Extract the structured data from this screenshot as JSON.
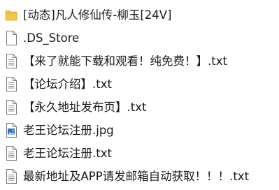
{
  "files": [
    {
      "name": "[动态]凡人修仙传-柳玉[24V]",
      "icon": "folder-icon"
    },
    {
      "name": ".DS_Store",
      "icon": "blank-file-icon"
    },
    {
      "name": "【来了就能下载和观看！纯免费！】.txt",
      "icon": "text-file-icon"
    },
    {
      "name": "【论坛介绍】.txt",
      "icon": "text-file-icon"
    },
    {
      "name": "【永久地址发布页】.txt",
      "icon": "text-file-icon"
    },
    {
      "name": "老王论坛注册.jpg",
      "icon": "image-file-icon"
    },
    {
      "name": "老王论坛注册.txt",
      "icon": "text-file-icon"
    },
    {
      "name": "最新地址及APP请发邮箱自动获取！！！.txt",
      "icon": "text-file-icon"
    }
  ],
  "colors": {
    "folder": "#f5c542",
    "folder_dark": "#dba629",
    "file_border": "#7a7a7a",
    "text_lines": "#8a8a8a",
    "image_blue": "#2f6fc4"
  }
}
